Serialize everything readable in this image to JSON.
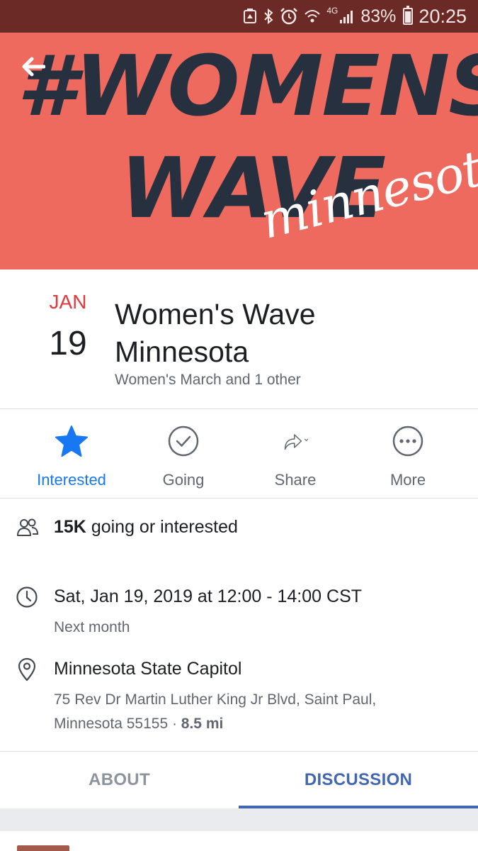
{
  "status_bar": {
    "network_label": "4G",
    "battery_percent": "83%",
    "time": "20:25",
    "icons": [
      "recycle-icon",
      "bluetooth-icon",
      "alarm-icon",
      "wifi-icon",
      "signal-icon",
      "battery-icon"
    ]
  },
  "banner": {
    "line1": "#WOMENS",
    "line2": "WAVE",
    "script": "minnesota",
    "colors": {
      "background": "#ee6a5e",
      "text": "#27303f",
      "script": "#ffffff"
    }
  },
  "event": {
    "month": "JAN",
    "day": "19",
    "title": "Women's Wave Minnesota",
    "host": "Women's March and 1 other"
  },
  "actions": [
    {
      "label": "Interested",
      "icon": "star-icon",
      "active": true
    },
    {
      "label": "Going",
      "icon": "check-circle-icon",
      "active": false
    },
    {
      "label": "Share",
      "icon": "share-arrow-icon",
      "active": false
    },
    {
      "label": "More",
      "icon": "more-dots-icon",
      "active": false
    }
  ],
  "details": {
    "attendance": {
      "count": "15K",
      "text": " going or interested"
    },
    "time": {
      "main": "Sat, Jan 19, 2019 at 12:00 - 14:00 CST",
      "sub": "Next month"
    },
    "location": {
      "name": "Minnesota State Capitol",
      "address_line1": "75 Rev Dr Martin Luther King Jr Blvd, Saint Paul,",
      "address_line2": "Minnesota 55155 · ",
      "distance": "8.5 mi"
    }
  },
  "tabs": [
    {
      "label": "ABOUT",
      "active": false
    },
    {
      "label": "DISCUSSION",
      "active": true
    }
  ],
  "colors": {
    "accent": "#1877f2",
    "tab_active": "#4267b2",
    "date_month": "#e0393e",
    "status_bar": "#6b2a25"
  }
}
